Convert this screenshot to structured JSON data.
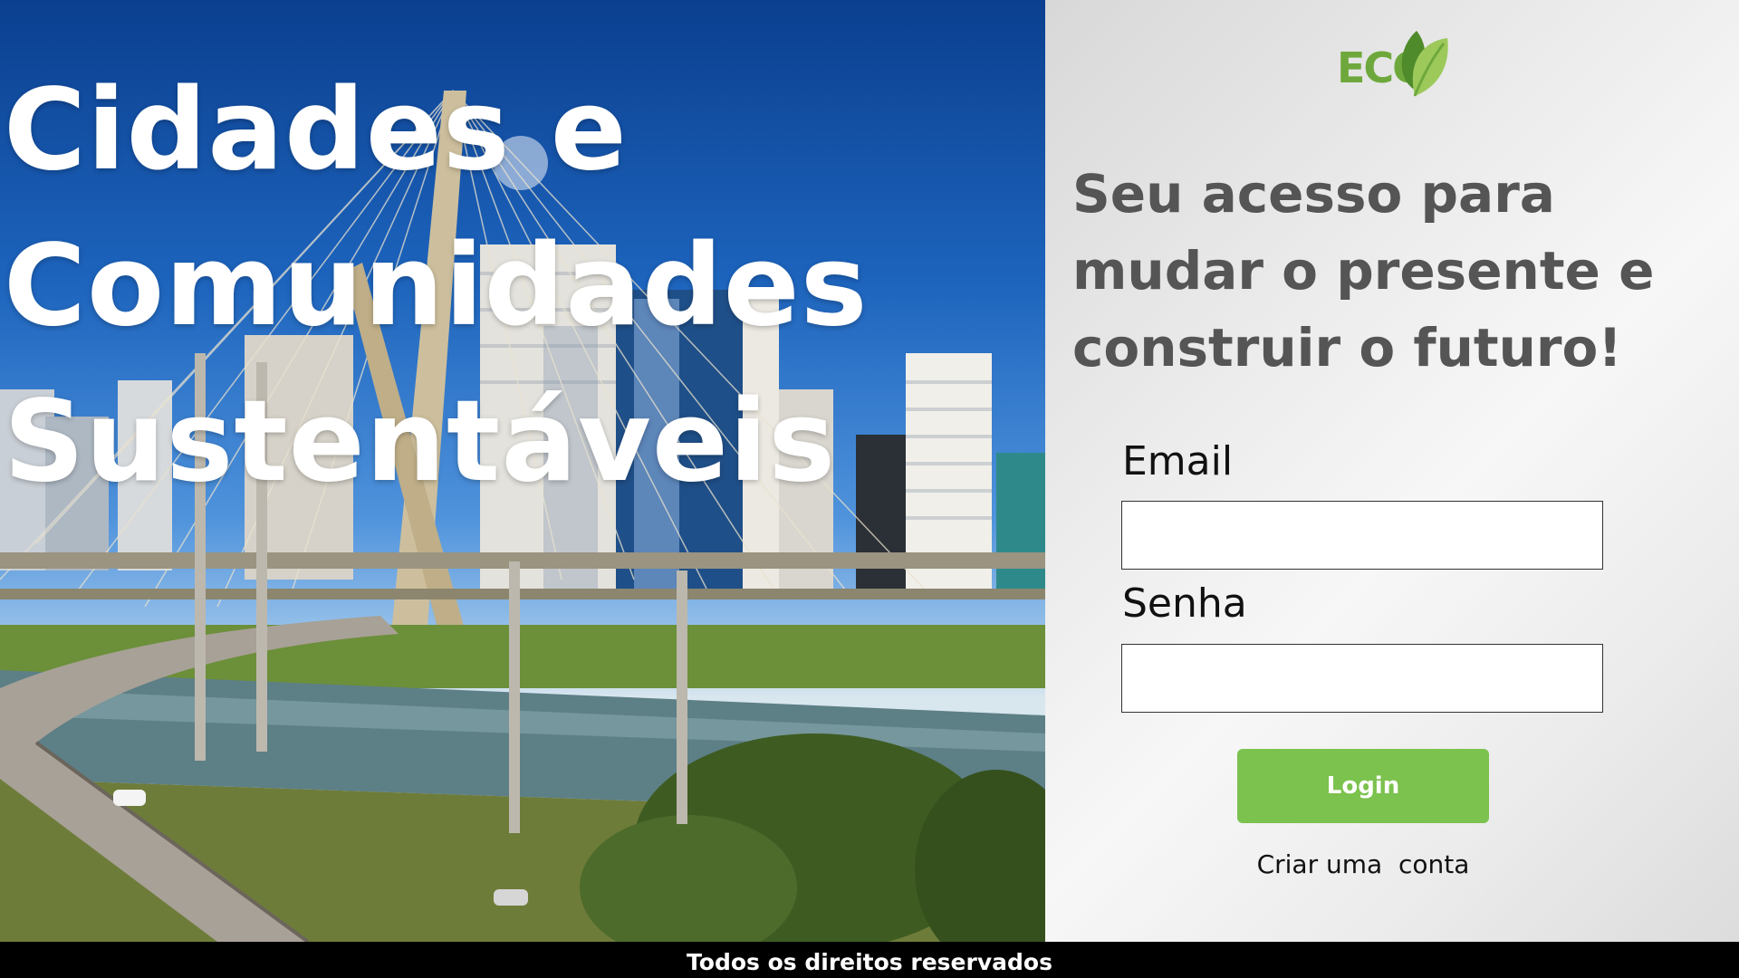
{
  "hero": {
    "title_lines": [
      "Cidades e",
      "Comunidades",
      "Sustentáveis"
    ]
  },
  "logo": {
    "text": "ECO",
    "icon": "leaf-icon",
    "color": "#6ea83c"
  },
  "panel": {
    "tagline": "Seu acesso para mudar o presente e construir o futuro!"
  },
  "form": {
    "email_label": "Email",
    "email_value": "",
    "password_label": "Senha",
    "password_value": "",
    "login_label": "Login",
    "signup_label": "Criar uma  conta"
  },
  "footer": {
    "text": "Todos os direitos reservados"
  },
  "colors": {
    "accent_green": "#7cc24e",
    "tagline_gray": "#555555",
    "footer_bg": "#000000"
  }
}
